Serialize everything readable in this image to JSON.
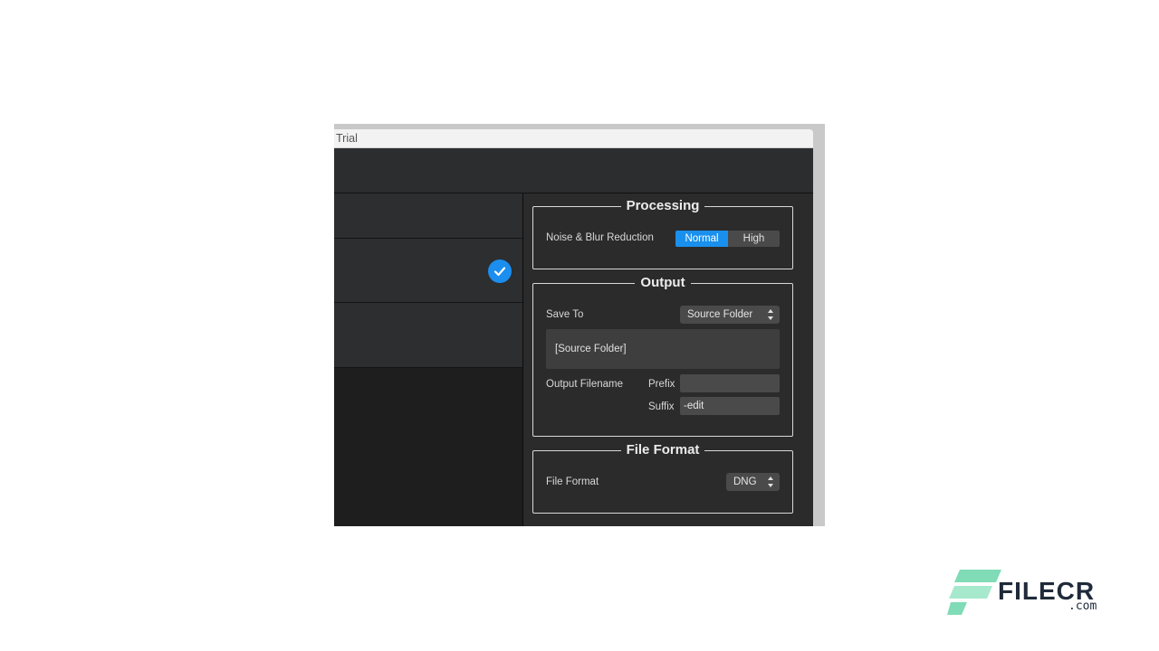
{
  "window": {
    "title": "Trial"
  },
  "accent_color": "#1a90ee",
  "processing": {
    "title": "Processing",
    "noise_label": "Noise & Blur Reduction",
    "options": [
      "Normal",
      "High"
    ],
    "selected": "Normal"
  },
  "output": {
    "title": "Output",
    "save_to_label": "Save To",
    "save_to_value": "Source Folder",
    "path_display": "[Source Folder]",
    "filename_label": "Output Filename",
    "prefix_label": "Prefix",
    "prefix_value": "",
    "suffix_label": "Suffix",
    "suffix_value": "-edit"
  },
  "file_format": {
    "title": "File Format",
    "label": "File Format",
    "value": "DNG"
  },
  "list": {
    "rows": [
      {
        "checked": false
      },
      {
        "checked": true
      },
      {
        "checked": false
      }
    ]
  },
  "watermark": {
    "brand": "FILECR",
    "domain": ".com",
    "icon": "filecr-logo-icon"
  }
}
